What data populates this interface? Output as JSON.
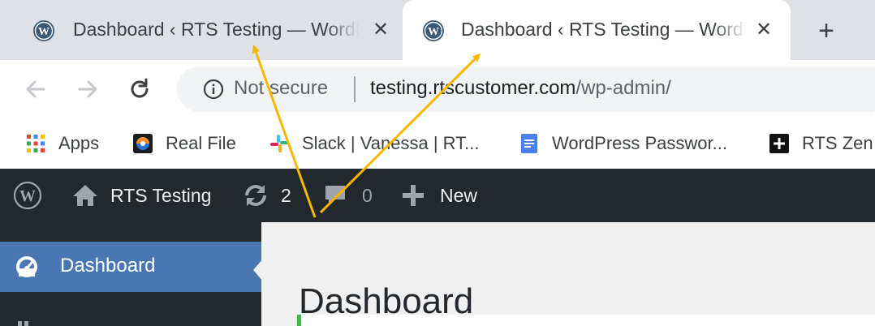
{
  "browser": {
    "tabs": [
      {
        "title": "Dashboard ‹ RTS Testing — WordPress",
        "favicon": "wordpress-icon",
        "active": false
      },
      {
        "title": "Dashboard ‹ RTS Testing — WordPress",
        "favicon": "wordpress-icon",
        "active": true
      }
    ],
    "close_glyph": "✕",
    "new_tab_glyph": "+",
    "omnibox": {
      "security_label": "Not secure",
      "url_host": "testing.rtscustomer.com",
      "url_path": "/wp-admin/"
    },
    "bookmarks": [
      {
        "label": "Apps",
        "icon": "apps-grid-icon"
      },
      {
        "label": "Real File",
        "icon": "real-file-icon"
      },
      {
        "label": "Slack | Vanessa | RT...",
        "icon": "slack-icon"
      },
      {
        "label": "WordPress Passwor...",
        "icon": "docs-icon"
      },
      {
        "label": "RTS Zen",
        "icon": "plus-box-icon"
      }
    ]
  },
  "wp_adminbar": {
    "site_name": "RTS Testing",
    "updates_count": "2",
    "comments_count": "0",
    "new_label": "New"
  },
  "wp_menu": {
    "items": [
      {
        "label": "Dashboard",
        "icon": "dashboard-gauge-icon",
        "active": true
      }
    ]
  },
  "wp_content": {
    "page_title": "Dashboard"
  },
  "colors": {
    "tabstrip_bg": "#dee1e6",
    "adminbar_bg": "#23282d",
    "menu_active_bg": "#4a77b2",
    "content_bg": "#f1f1f1",
    "annotation_arrow": "#f5b800"
  }
}
